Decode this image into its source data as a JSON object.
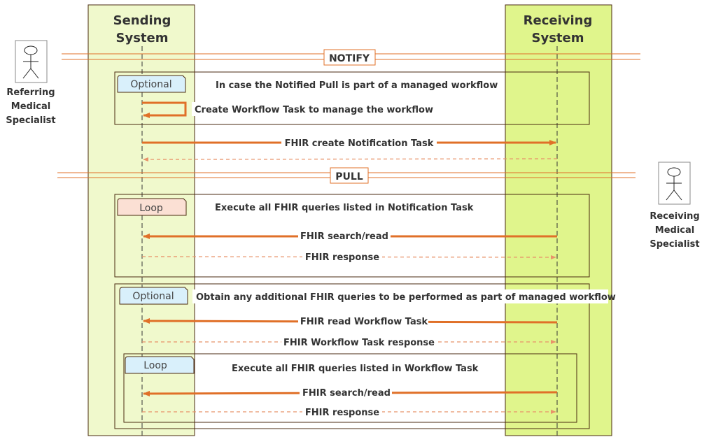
{
  "participants": {
    "sending": {
      "line1": "Sending",
      "line2": "System",
      "color": "#f0f9cc"
    },
    "receiving": {
      "line1": "Receiving",
      "line2": "System",
      "color": "#e0f58c"
    }
  },
  "actors": {
    "referring": {
      "line1": "Referring",
      "line2": "Medical",
      "line3": "Specialist"
    },
    "receiving": {
      "line1": "Receiving",
      "line2": "Medical",
      "line3": "Specialist"
    }
  },
  "sections": {
    "notify": "NOTIFY",
    "pull": "PULL"
  },
  "fragments": [
    {
      "tag": "Optional",
      "title": "In case the Notified Pull is part of a managed workflow",
      "tag_color": "#d9f0fb"
    },
    {
      "tag": "Loop",
      "title": "Execute all FHIR queries listed in Notification Task",
      "tag_color": "#fbe0d4"
    },
    {
      "tag": "Optional",
      "title": "Obtain any additional FHIR queries to be performed as part of managed workflow",
      "tag_color": "#d9f0fb"
    },
    {
      "tag": "Loop",
      "title": "Execute all FHIR queries listed in Workflow Task",
      "tag_color": "#d9f0fb"
    }
  ],
  "messages": {
    "self_task": "Create Workflow Task to manage the workflow",
    "create_notification": "FHIR create Notification Task",
    "search1": "FHIR search/read",
    "response1": "FHIR response",
    "read_workflow": "FHIR read Workflow Task",
    "workflow_response": "FHIR Workflow Task response",
    "search2": "FHIR search/read",
    "response2": "FHIR response"
  },
  "colors": {
    "arrow": "#e07028",
    "border": "#4a2a10"
  }
}
